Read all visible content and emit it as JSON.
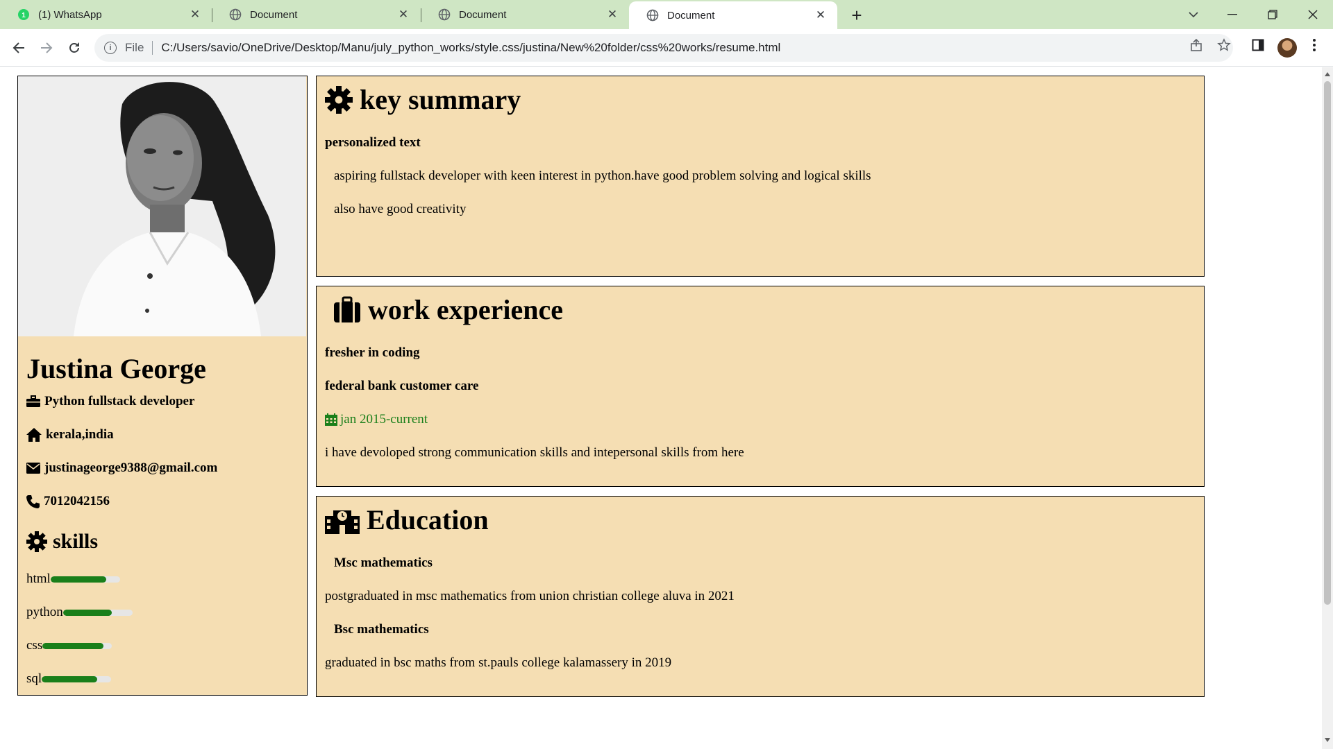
{
  "browser": {
    "tabs": [
      {
        "title": "(1) WhatsApp",
        "badge": "1",
        "active": false
      },
      {
        "title": "Document",
        "active": false
      },
      {
        "title": "Document",
        "active": false
      },
      {
        "title": "Document",
        "active": true
      }
    ],
    "address": {
      "scheme": "File",
      "url": "C:/Users/savio/OneDrive/Desktop/Manu/july_python_works/style.css/justina/New%20folder/css%20works/resume.html"
    }
  },
  "profile": {
    "name": "Justina George",
    "role": "Python fullstack developer",
    "location": "kerala,india",
    "email": "justinageorge9388@gmail.com",
    "phone": "7012042156"
  },
  "skills": {
    "title": "skills",
    "items": [
      {
        "label": "html",
        "level": 0.8
      },
      {
        "label": "python",
        "level": 0.7
      },
      {
        "label": "css",
        "level": 0.88
      },
      {
        "label": "sql",
        "level": 0.8
      }
    ]
  },
  "summary": {
    "title": "key summary",
    "subtitle": "personalized text",
    "lines": [
      "aspiring fullstack developer with keen interest in python.have good problem solving and logical skills",
      "also have good creativity"
    ]
  },
  "experience": {
    "title": "work experience",
    "headline": "fresher in coding",
    "job": "federal bank customer care",
    "period": "jan 2015-current",
    "description": "i have devoloped strong communication skills and intepersonal skills from here"
  },
  "education": {
    "title": "Education",
    "entries": [
      {
        "degree": "Msc mathematics",
        "detail": "postgraduated in msc mathematics from union christian college aluva in 2021"
      },
      {
        "degree": "Bsc mathematics",
        "detail": "graduated in bsc maths from st.pauls college kalamassery in 2019"
      }
    ]
  },
  "colors": {
    "tabbar": "#cfe6c4",
    "panel": "#f5deb3",
    "accent_green": "#1a7f1a"
  }
}
